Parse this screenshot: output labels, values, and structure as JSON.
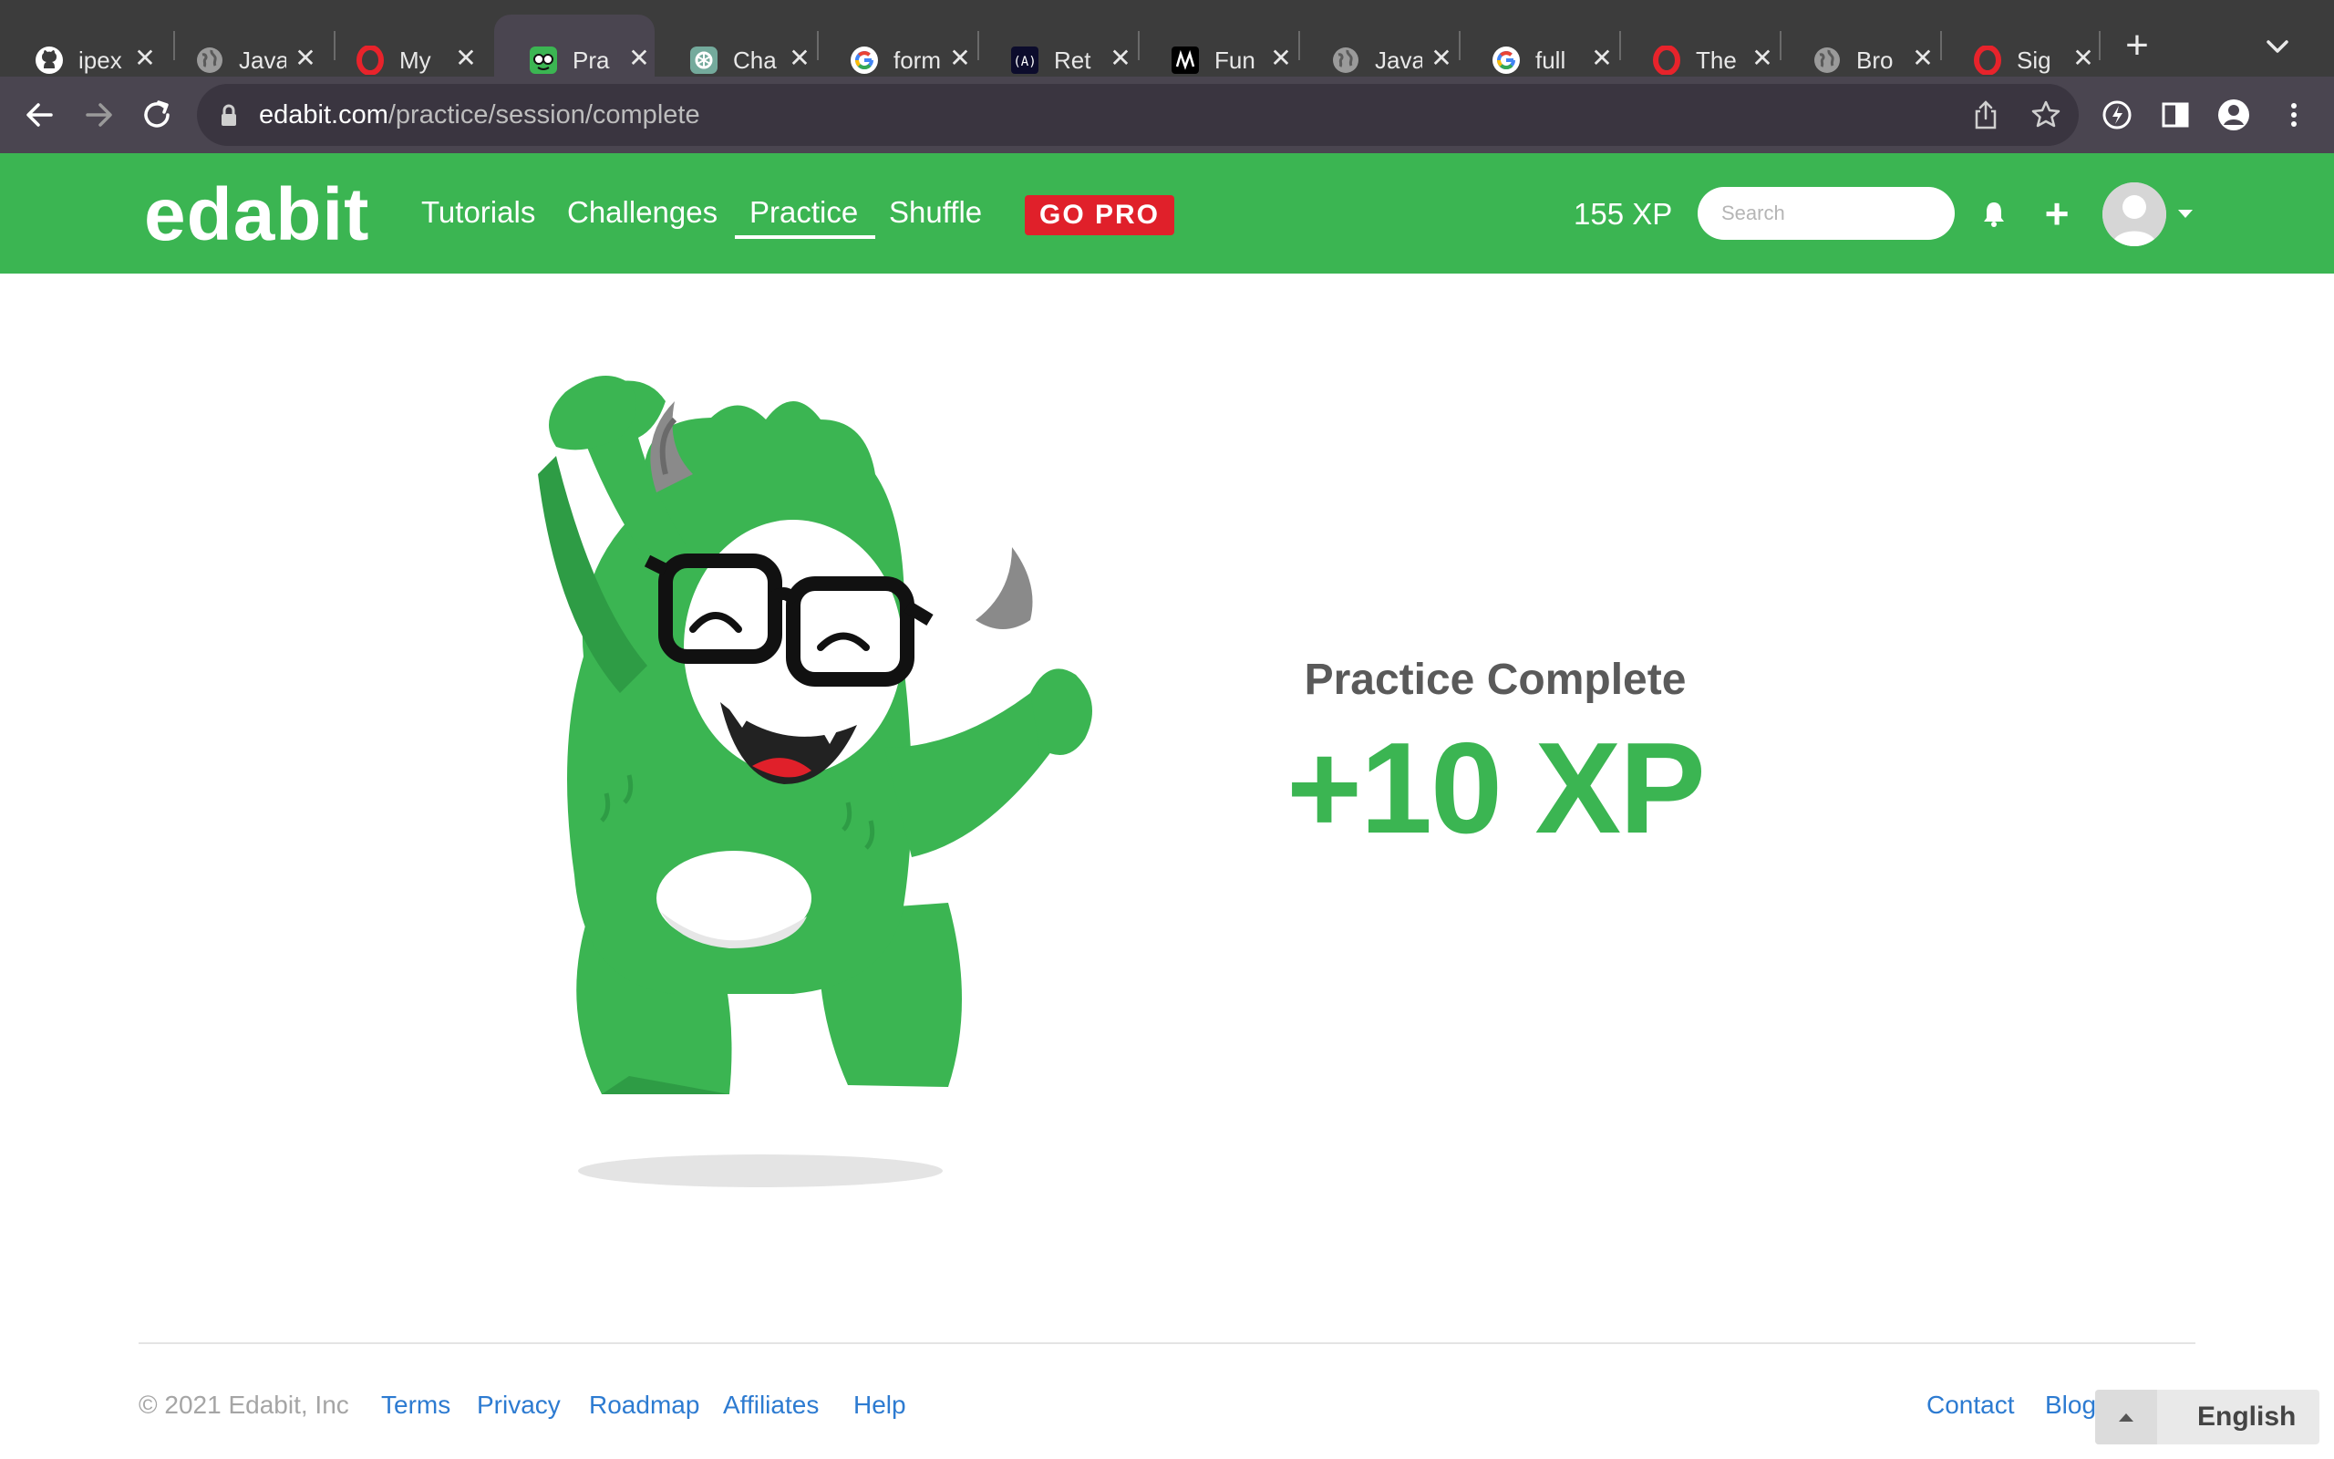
{
  "browser": {
    "tabs": [
      {
        "title": "ipex",
        "icon": "github-icon"
      },
      {
        "title": "Java",
        "icon": "globe-icon"
      },
      {
        "title": "My",
        "icon": "opera-icon"
      },
      {
        "title": "Pra",
        "icon": "edabit-icon",
        "active": true
      },
      {
        "title": "Cha",
        "icon": "chatgpt-icon"
      },
      {
        "title": "form",
        "icon": "google-icon"
      },
      {
        "title": "Ret",
        "icon": "scrimba-icon"
      },
      {
        "title": "Fun",
        "icon": "medium-icon"
      },
      {
        "title": "Java",
        "icon": "globe-icon"
      },
      {
        "title": "full",
        "icon": "google-icon"
      },
      {
        "title": "The",
        "icon": "opera-icon"
      },
      {
        "title": "Bro",
        "icon": "globe-icon"
      },
      {
        "title": "Sig",
        "icon": "opera-icon"
      }
    ],
    "tab_close_glyph": "✕",
    "new_tab_glyph": "+",
    "url_host": "edabit.com",
    "url_path": "/practice/session/complete"
  },
  "header": {
    "logo": "edabit",
    "nav": {
      "tutorials": "Tutorials",
      "challenges": "Challenges",
      "practice": "Practice",
      "shuffle": "Shuffle"
    },
    "go_pro": "GO PRO",
    "xp_total": "155 XP",
    "search_placeholder": "Search",
    "add_glyph": "+"
  },
  "main": {
    "title": "Practice Complete",
    "xp_gain": "+10 XP"
  },
  "footer": {
    "copyright": "© 2021 Edabit, Inc",
    "links": {
      "terms": "Terms",
      "privacy": "Privacy",
      "roadmap": "Roadmap",
      "affiliates": "Affiliates",
      "help": "Help",
      "contact": "Contact",
      "blog": "Blog"
    },
    "language": "English"
  },
  "colors": {
    "brand_green": "#3bb552",
    "pro_red": "#e0202a",
    "link_blue": "#2d7bd1"
  }
}
